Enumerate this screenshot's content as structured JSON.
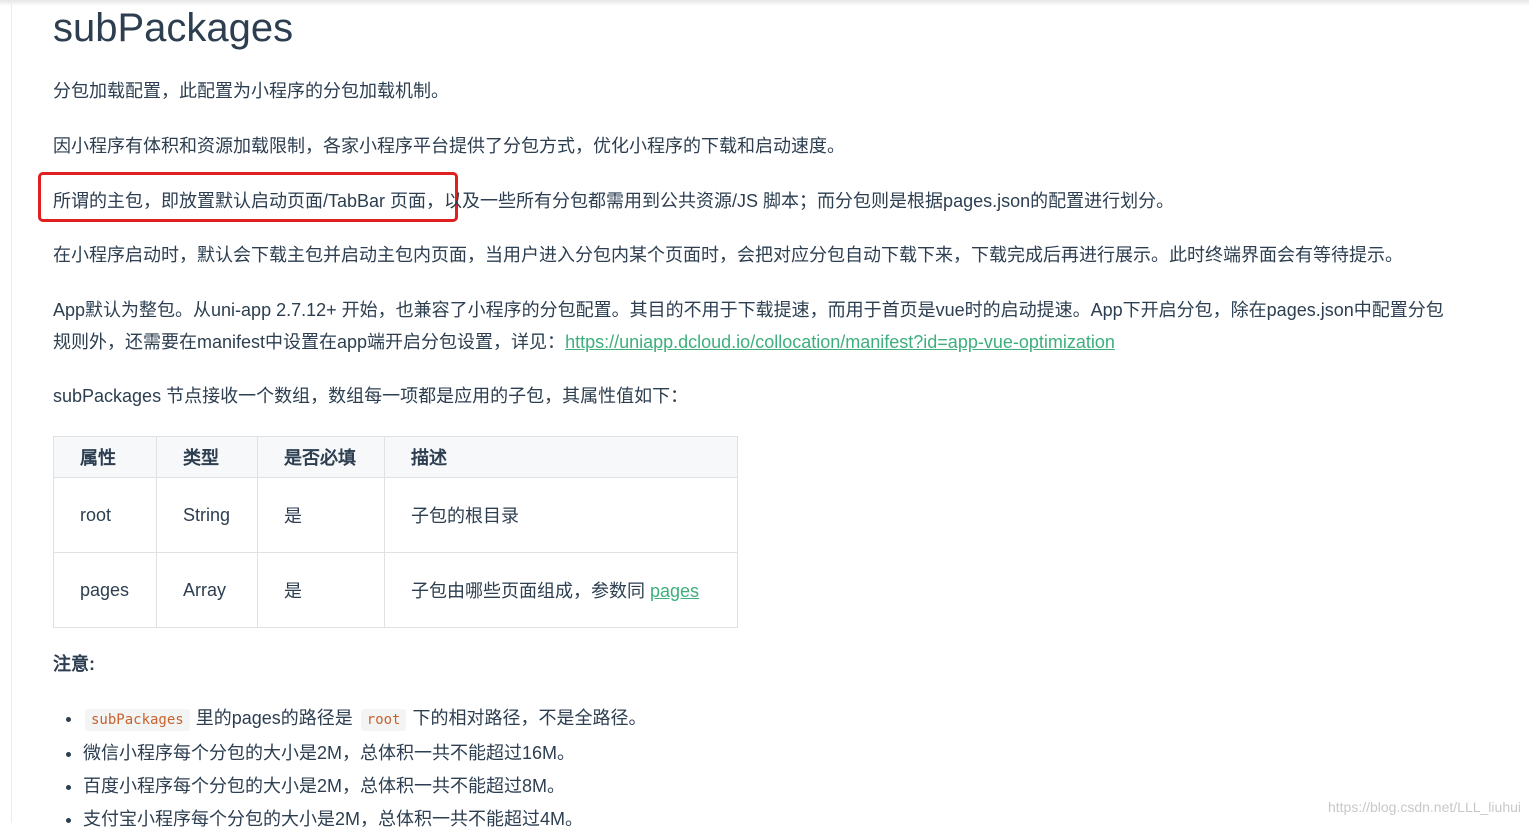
{
  "title": "subPackages",
  "paragraphs": {
    "p1": "分包加载配置，此配置为小程序的分包加载机制。",
    "p2": "因小程序有体积和资源加载限制，各家小程序平台提供了分包方式，优化小程序的下载和启动速度。",
    "p3_highlight": "所谓的主包，即放置默认启动页面/TabBar 页面，",
    "p3_rest": "以及一些所有分包都需用到公共资源/JS 脚本；而分包则是根据pages.json的配置进行划分。",
    "p4": "在小程序启动时，默认会下载主包并启动主包内页面，当用户进入分包内某个页面时，会把对应分包自动下载下来，下载完成后再进行展示。此时终端界面会有等待提示。",
    "p5_line1": "App默认为整包。从uni-app 2.7.12+ 开始，也兼容了小程序的分包配置。其目的不用于下载提速，而用于首页是vue时的启动提速。App下开启分包，除在pages.json中配置分包",
    "p5_line2": "规则外，还需要在manifest中设置在app端开启分包设置，详见：",
    "p5_link": "https://uniapp.dcloud.io/collocation/manifest?id=app-vue-optimization",
    "p6": "subPackages 节点接收一个数组，数组每一项都是应用的子包，其属性值如下："
  },
  "table": {
    "headers": [
      "属性",
      "类型",
      "是否必填",
      "描述"
    ],
    "rows": [
      {
        "attr": "root",
        "type": "String",
        "required": "是",
        "desc": "子包的根目录",
        "link": ""
      },
      {
        "attr": "pages",
        "type": "Array",
        "required": "是",
        "desc": "子包由哪些页面组成，参数同 ",
        "link": "pages"
      }
    ]
  },
  "note": {
    "title": "注意:",
    "items": {
      "i1_code1": "subPackages",
      "i1_mid": "里的pages的路径是",
      "i1_code2": "root",
      "i1_tail": "下的相对路径，不是全路径。",
      "i2": "微信小程序每个分包的大小是2M，总体积一共不能超过16M。",
      "i3": "百度小程序每个分包的大小是2M，总体积一共不能超过8M。",
      "i4": "支付宝小程序每个分包的大小是2M，总体积一共不能超过4M。"
    }
  },
  "watermark": "https://blog.csdn.net/LLL_liuhui",
  "colors": {
    "text": "#2c3e50",
    "link": "#3eaf7c",
    "highlight_border": "#e02020",
    "code": "#c7612d"
  }
}
